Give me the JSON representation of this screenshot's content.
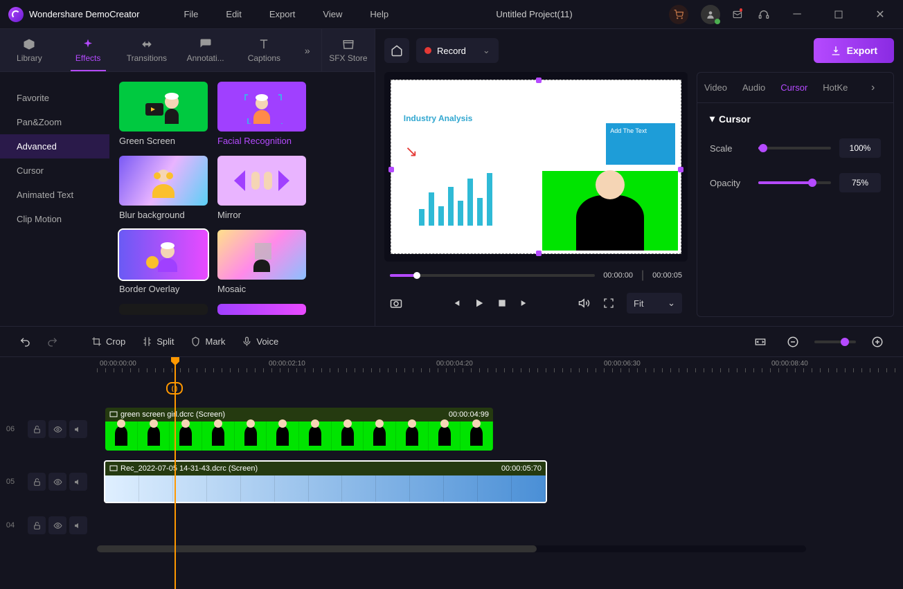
{
  "app": {
    "name": "Wondershare DemoCreator",
    "project": "Untitled Project(11)"
  },
  "menus": {
    "file": "File",
    "edit": "Edit",
    "export": "Export",
    "view": "View",
    "help": "Help"
  },
  "tabs": {
    "library": "Library",
    "effects": "Effects",
    "transitions": "Transitions",
    "annotations": "Annotati...",
    "captions": "Captions",
    "sfx": "SFX Store"
  },
  "categories": {
    "favorite": "Favorite",
    "panzoom": "Pan&Zoom",
    "advanced": "Advanced",
    "cursor": "Cursor",
    "animated": "Animated Text",
    "clipmotion": "Clip Motion"
  },
  "effects": {
    "green_screen": "Green Screen",
    "facial": "Facial Recognition",
    "blur": "Blur background",
    "mirror": "Mirror",
    "border": "Border Overlay",
    "mosaic": "Mosaic"
  },
  "record": "Record",
  "export_btn": "Export",
  "player": {
    "cur": "00:00:00",
    "dur": "00:00:05",
    "fit": "Fit"
  },
  "props": {
    "tabs": {
      "video": "Video",
      "audio": "Audio",
      "cursor": "Cursor",
      "hotkey": "HotKe"
    },
    "section": "Cursor",
    "scale": {
      "label": "Scale",
      "value": "100%"
    },
    "opacity": {
      "label": "Opacity",
      "value": "75%"
    }
  },
  "tl_tools": {
    "crop": "Crop",
    "split": "Split",
    "mark": "Mark",
    "voice": "Voice"
  },
  "ruler": [
    "00:00:00:00",
    "00:00:02:10",
    "00:00:04:20",
    "00:00:06:30",
    "00:00:08:40"
  ],
  "tracks": {
    "t06": "06",
    "t05": "05",
    "t04": "04",
    "clip1": {
      "name": "green screen girl.dcrc (Screen)",
      "dur": "00:00:04:99"
    },
    "clip2": {
      "name": "Rec_2022-07-05 14-31-43.dcrc (Screen)",
      "dur": "00:00:05:70"
    }
  },
  "slide": {
    "title": "Industry Analysis",
    "callout": "Add The Text"
  }
}
